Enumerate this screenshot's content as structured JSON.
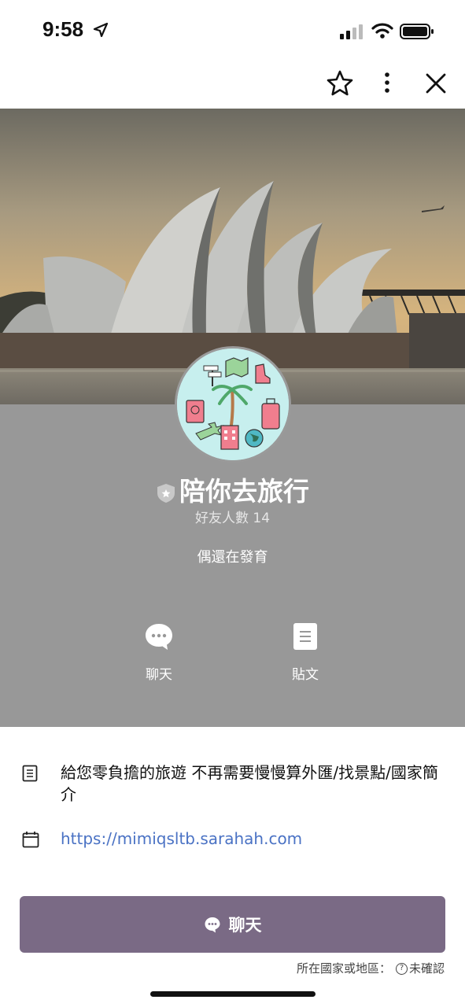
{
  "status_bar": {
    "time": "9:58"
  },
  "header": {
    "favorite_icon": "star-outline-icon",
    "more_icon": "more-vertical-icon",
    "close_icon": "close-icon"
  },
  "profile": {
    "name": "陪你去旅行",
    "friends_count": "好友人數 14",
    "status_message": "偶還在發育",
    "actions": [
      {
        "label": "聊天",
        "icon": "chat-bubble-icon"
      },
      {
        "label": "貼文",
        "icon": "post-document-icon"
      }
    ]
  },
  "info": {
    "description": "給您零負擔的旅遊 不再需要慢慢算外匯/找景點/國家簡介",
    "link": "https://mimiqsltb.sarahah.com"
  },
  "cta": {
    "label": "聊天"
  },
  "region": {
    "label": "所在國家或地區：",
    "value": "未確認"
  },
  "colors": {
    "accent": "#7a6a85",
    "link": "#4a72c4",
    "profile_bg": "#989898"
  }
}
